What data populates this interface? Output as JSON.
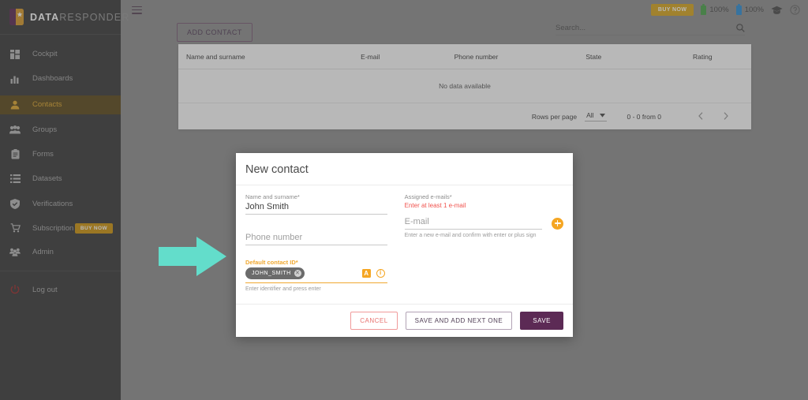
{
  "brand": {
    "part1": "DATA",
    "part2": "RESPONDER",
    "logo_icon": "head-profile-logo"
  },
  "sidebar": {
    "items": [
      {
        "label": "Cockpit",
        "icon": "dashboard-grid-icon",
        "active": false
      },
      {
        "label": "Dashboards",
        "icon": "bar-chart-icon",
        "active": false
      },
      {
        "label": "Contacts",
        "icon": "person-icon",
        "active": true
      },
      {
        "label": "Groups",
        "icon": "people-group-icon",
        "active": false
      },
      {
        "label": "Forms",
        "icon": "clipboard-icon",
        "active": false
      },
      {
        "label": "Datasets",
        "icon": "list-lines-icon",
        "active": false
      },
      {
        "label": "Verifications",
        "icon": "shield-check-icon",
        "active": false
      },
      {
        "label": "Subscription",
        "icon": "shopping-cart-icon",
        "active": false,
        "badge": "BUY NOW"
      },
      {
        "label": "Admin",
        "icon": "people-admin-icon",
        "active": false
      }
    ],
    "logout": {
      "label": "Log out",
      "icon": "power-icon"
    }
  },
  "topbar": {
    "menu_icon": "hamburger-menu-icon",
    "buy_now": "BUY NOW",
    "meter_green": "100%",
    "meter_blue": "100%",
    "graduation_icon": "graduation-cap-icon",
    "help_icon": "help-circle-icon"
  },
  "toolbar": {
    "add_contact": "ADD CONTACT",
    "search_placeholder": "Search...",
    "search_value": "",
    "search_icon": "search-icon"
  },
  "table": {
    "columns": [
      "Name and surname",
      "E-mail",
      "Phone number",
      "State",
      "Rating"
    ],
    "empty_message": "No data available"
  },
  "pagination": {
    "rows_per_page_label": "Rows per page",
    "rows_per_page_value": "All",
    "range": "0 - 0 from 0",
    "prev_icon": "chevron-left-icon",
    "next_icon": "chevron-right-icon"
  },
  "dialog": {
    "title": "New contact",
    "name_label": "Name and surname*",
    "name_value": "John Smith",
    "phone_label": "Phone number",
    "phone_value": "",
    "contact_id_label": "Default contact ID*",
    "contact_id_chip": "JOHN_SMITH",
    "contact_id_chip_remove": "✕",
    "contact_id_hint": "Enter identifier and press enter",
    "badge_a": "A",
    "info_icon_glyph": "i",
    "assigned_emails_label": "Assigned e-mails*",
    "assigned_emails_error": "Enter at least 1 e-mail",
    "email_placeholder": "E-mail",
    "email_value": "",
    "email_hint": "Enter a new e-mail and confirm with enter or plus sign",
    "add_email_icon": "plus-circle-icon",
    "cancel": "CANCEL",
    "save_and_next": "SAVE AND ADD NEXT ONE",
    "save": "SAVE"
  },
  "annotation": {
    "arrow_icon": "right-arrow-annotation",
    "color": "#63ddcb"
  },
  "colors": {
    "sidebar_bg": "#3b3b3b",
    "active_nav": "#5c4a1a",
    "accent_orange": "#f0a830",
    "accent_purple": "#5c2a55",
    "error_red": "#f0524d",
    "buy_now": "#d9a61f"
  }
}
